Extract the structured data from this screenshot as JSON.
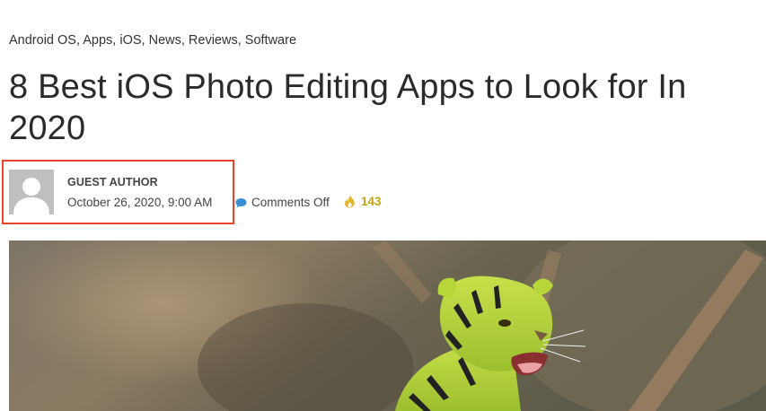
{
  "post": {
    "categories": [
      "Android OS",
      "Apps",
      "iOS",
      "News",
      "Reviews",
      "Software"
    ],
    "category_separator": ", ",
    "title": "8 Best iOS Photo Editing Apps to Look for In 2020",
    "author": "GUEST AUTHOR",
    "date": "October 26, 2020, 9:00 AM",
    "comments": "Comments Off",
    "views": "143"
  },
  "icons": {
    "avatar": "default-avatar-icon",
    "comments": "speech-bubble-icon",
    "views": "flame-icon"
  },
  "colors": {
    "highlight_border": "#e8412c",
    "views_accent": "#c9a21a",
    "comment_icon": "#3b8fd6",
    "avatar_bg": "#bfbfbf"
  }
}
